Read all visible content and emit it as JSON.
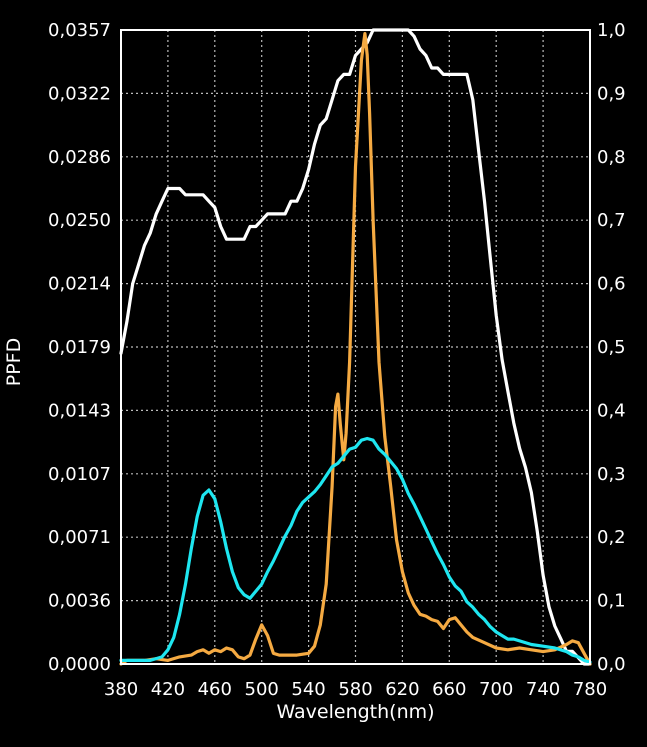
{
  "chart_data": {
    "type": "line",
    "title": "",
    "xlabel": "Wavelength(nm)",
    "ylabel": "PPFD",
    "xlim": [
      380,
      780
    ],
    "ylim": [
      0,
      0.0357
    ],
    "y2lim": [
      0,
      1.0
    ],
    "grid": true,
    "background": "#000000",
    "x_ticks": [
      "380",
      "420",
      "460",
      "500",
      "540",
      "580",
      "620",
      "660",
      "700",
      "740",
      "780"
    ],
    "y_ticks": [
      "0,0000",
      "0,0036",
      "0,0071",
      "0,0107",
      "0,0143",
      "0,0179",
      "0,0214",
      "0,0250",
      "0,0286",
      "0,0322",
      "0,0357"
    ],
    "y2_ticks": [
      "0,0",
      "0,1",
      "0,2",
      "0,3",
      "0,4",
      "0,5",
      "0,6",
      "0,7",
      "0,8",
      "0,9",
      "1,0"
    ],
    "series": [
      {
        "color": "#ffffff",
        "axis": "right",
        "points": [
          [
            380,
            0.49
          ],
          [
            385,
            0.54
          ],
          [
            390,
            0.6
          ],
          [
            395,
            0.63
          ],
          [
            400,
            0.66
          ],
          [
            405,
            0.68
          ],
          [
            410,
            0.71
          ],
          [
            415,
            0.73
          ],
          [
            420,
            0.75
          ],
          [
            425,
            0.75
          ],
          [
            430,
            0.75
          ],
          [
            435,
            0.74
          ],
          [
            440,
            0.74
          ],
          [
            445,
            0.74
          ],
          [
            450,
            0.74
          ],
          [
            455,
            0.73
          ],
          [
            460,
            0.72
          ],
          [
            465,
            0.69
          ],
          [
            470,
            0.67
          ],
          [
            475,
            0.67
          ],
          [
            480,
            0.67
          ],
          [
            485,
            0.67
          ],
          [
            490,
            0.69
          ],
          [
            495,
            0.69
          ],
          [
            500,
            0.7
          ],
          [
            505,
            0.71
          ],
          [
            510,
            0.71
          ],
          [
            515,
            0.71
          ],
          [
            520,
            0.71
          ],
          [
            525,
            0.73
          ],
          [
            530,
            0.73
          ],
          [
            535,
            0.75
          ],
          [
            540,
            0.78
          ],
          [
            545,
            0.82
          ],
          [
            550,
            0.85
          ],
          [
            555,
            0.86
          ],
          [
            560,
            0.89
          ],
          [
            565,
            0.92
          ],
          [
            570,
            0.93
          ],
          [
            575,
            0.93
          ],
          [
            580,
            0.96
          ],
          [
            585,
            0.97
          ],
          [
            590,
            0.98
          ],
          [
            595,
            1.0
          ],
          [
            600,
            1.0
          ],
          [
            605,
            1.0
          ],
          [
            610,
            1.0
          ],
          [
            615,
            1.0
          ],
          [
            620,
            1.0
          ],
          [
            625,
            1.0
          ],
          [
            630,
            0.99
          ],
          [
            635,
            0.97
          ],
          [
            640,
            0.96
          ],
          [
            645,
            0.94
          ],
          [
            650,
            0.94
          ],
          [
            655,
            0.93
          ],
          [
            660,
            0.93
          ],
          [
            665,
            0.93
          ],
          [
            670,
            0.93
          ],
          [
            675,
            0.93
          ],
          [
            680,
            0.89
          ],
          [
            685,
            0.81
          ],
          [
            690,
            0.73
          ],
          [
            695,
            0.64
          ],
          [
            700,
            0.55
          ],
          [
            705,
            0.48
          ],
          [
            710,
            0.43
          ],
          [
            715,
            0.38
          ],
          [
            720,
            0.34
          ],
          [
            725,
            0.31
          ],
          [
            730,
            0.27
          ],
          [
            735,
            0.21
          ],
          [
            740,
            0.14
          ],
          [
            745,
            0.09
          ],
          [
            750,
            0.06
          ],
          [
            755,
            0.04
          ],
          [
            760,
            0.02
          ],
          [
            765,
            0.02
          ],
          [
            770,
            0.01
          ],
          [
            775,
            0.0
          ],
          [
            780,
            0.0
          ]
        ]
      },
      {
        "color": "#f5aa42",
        "axis": "left",
        "points": [
          [
            380,
            0.0
          ],
          [
            385,
            0.0002
          ],
          [
            390,
            0.0002
          ],
          [
            400,
            0.0002
          ],
          [
            410,
            0.0003
          ],
          [
            420,
            0.0002
          ],
          [
            430,
            0.0004
          ],
          [
            440,
            0.0005
          ],
          [
            445,
            0.0007
          ],
          [
            450,
            0.0008
          ],
          [
            455,
            0.0006
          ],
          [
            460,
            0.0008
          ],
          [
            465,
            0.0007
          ],
          [
            470,
            0.0009
          ],
          [
            475,
            0.0008
          ],
          [
            480,
            0.0004
          ],
          [
            485,
            0.0003
          ],
          [
            490,
            0.0005
          ],
          [
            495,
            0.0014
          ],
          [
            500,
            0.0022
          ],
          [
            505,
            0.0016
          ],
          [
            510,
            0.0006
          ],
          [
            515,
            0.0005
          ],
          [
            520,
            0.0005
          ],
          [
            530,
            0.0005
          ],
          [
            540,
            0.0006
          ],
          [
            545,
            0.001
          ],
          [
            550,
            0.0022
          ],
          [
            555,
            0.0045
          ],
          [
            560,
            0.01
          ],
          [
            563,
            0.0145
          ],
          [
            565,
            0.0152
          ],
          [
            567,
            0.0135
          ],
          [
            570,
            0.0115
          ],
          [
            572,
            0.013
          ],
          [
            575,
            0.017
          ],
          [
            580,
            0.028
          ],
          [
            585,
            0.034
          ],
          [
            588,
            0.0355
          ],
          [
            590,
            0.0343
          ],
          [
            592,
            0.031
          ],
          [
            595,
            0.025
          ],
          [
            600,
            0.017
          ],
          [
            605,
            0.0128
          ],
          [
            610,
            0.01
          ],
          [
            615,
            0.007
          ],
          [
            620,
            0.0052
          ],
          [
            625,
            0.004
          ],
          [
            630,
            0.0033
          ],
          [
            635,
            0.0028
          ],
          [
            640,
            0.0027
          ],
          [
            645,
            0.0025
          ],
          [
            650,
            0.0024
          ],
          [
            655,
            0.002
          ],
          [
            660,
            0.0025
          ],
          [
            665,
            0.0026
          ],
          [
            670,
            0.0022
          ],
          [
            675,
            0.0018
          ],
          [
            680,
            0.0015
          ],
          [
            690,
            0.0012
          ],
          [
            700,
            0.0009
          ],
          [
            710,
            0.0008
          ],
          [
            720,
            0.0009
          ],
          [
            730,
            0.0008
          ],
          [
            740,
            0.0007
          ],
          [
            750,
            0.0008
          ],
          [
            760,
            0.0011
          ],
          [
            765,
            0.0013
          ],
          [
            770,
            0.0012
          ],
          [
            775,
            0.0006
          ],
          [
            780,
            0.0
          ]
        ]
      },
      {
        "color": "#1ee6f0",
        "axis": "left",
        "points": [
          [
            380,
            0.0002
          ],
          [
            385,
            0.0002
          ],
          [
            395,
            0.0002
          ],
          [
            405,
            0.0002
          ],
          [
            415,
            0.0004
          ],
          [
            420,
            0.0008
          ],
          [
            425,
            0.0015
          ],
          [
            430,
            0.0028
          ],
          [
            435,
            0.0045
          ],
          [
            440,
            0.0065
          ],
          [
            445,
            0.0083
          ],
          [
            450,
            0.0095
          ],
          [
            455,
            0.0098
          ],
          [
            460,
            0.0093
          ],
          [
            465,
            0.008
          ],
          [
            470,
            0.0065
          ],
          [
            475,
            0.0052
          ],
          [
            480,
            0.0043
          ],
          [
            485,
            0.0039
          ],
          [
            490,
            0.0037
          ],
          [
            495,
            0.0041
          ],
          [
            500,
            0.0045
          ],
          [
            505,
            0.0052
          ],
          [
            510,
            0.0058
          ],
          [
            515,
            0.0065
          ],
          [
            520,
            0.0072
          ],
          [
            525,
            0.0078
          ],
          [
            530,
            0.0086
          ],
          [
            535,
            0.0091
          ],
          [
            540,
            0.0094
          ],
          [
            545,
            0.0097
          ],
          [
            550,
            0.0101
          ],
          [
            555,
            0.0106
          ],
          [
            560,
            0.0111
          ],
          [
            565,
            0.0113
          ],
          [
            570,
            0.0117
          ],
          [
            575,
            0.0121
          ],
          [
            580,
            0.0122
          ],
          [
            585,
            0.0126
          ],
          [
            590,
            0.0127
          ],
          [
            595,
            0.0126
          ],
          [
            600,
            0.0121
          ],
          [
            605,
            0.0118
          ],
          [
            610,
            0.0114
          ],
          [
            615,
            0.011
          ],
          [
            620,
            0.0104
          ],
          [
            625,
            0.0096
          ],
          [
            630,
            0.009
          ],
          [
            635,
            0.0083
          ],
          [
            640,
            0.0076
          ],
          [
            645,
            0.0069
          ],
          [
            650,
            0.0062
          ],
          [
            655,
            0.0056
          ],
          [
            660,
            0.0049
          ],
          [
            665,
            0.0044
          ],
          [
            670,
            0.0041
          ],
          [
            675,
            0.0035
          ],
          [
            680,
            0.0032
          ],
          [
            685,
            0.0028
          ],
          [
            690,
            0.0025
          ],
          [
            695,
            0.0021
          ],
          [
            700,
            0.0018
          ],
          [
            705,
            0.0016
          ],
          [
            710,
            0.0014
          ],
          [
            715,
            0.0014
          ],
          [
            720,
            0.0013
          ],
          [
            730,
            0.0011
          ],
          [
            740,
            0.001
          ],
          [
            750,
            0.0009
          ],
          [
            755,
            0.0008
          ],
          [
            760,
            0.0007
          ],
          [
            765,
            0.0005
          ],
          [
            770,
            0.0004
          ],
          [
            775,
            0.0002
          ],
          [
            780,
            0.0001
          ]
        ]
      }
    ]
  }
}
